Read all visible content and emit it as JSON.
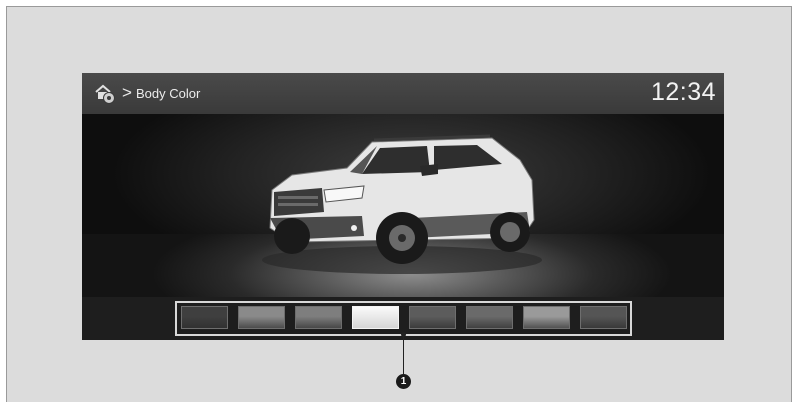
{
  "header": {
    "breadcrumb_separator": ">",
    "title": "Body Color",
    "clock": "12:34",
    "home_icon": "home-settings-icon"
  },
  "color_picker": {
    "swatches": [
      {
        "id": "swatch-1",
        "color": "#3f3f3f",
        "selected": false
      },
      {
        "id": "swatch-2",
        "color": "#8a8a8a",
        "selected": false
      },
      {
        "id": "swatch-3",
        "color": "#7e7e7e",
        "selected": false
      },
      {
        "id": "swatch-4",
        "color": "#d6d6d6",
        "selected": true
      },
      {
        "id": "swatch-5",
        "color": "#5c5c5c",
        "selected": false
      },
      {
        "id": "swatch-6",
        "color": "#6a6a6a",
        "selected": false
      },
      {
        "id": "swatch-7",
        "color": "#9a9a9a",
        "selected": false
      },
      {
        "id": "swatch-8",
        "color": "#555555",
        "selected": false
      }
    ]
  },
  "callout": {
    "label": "1"
  }
}
